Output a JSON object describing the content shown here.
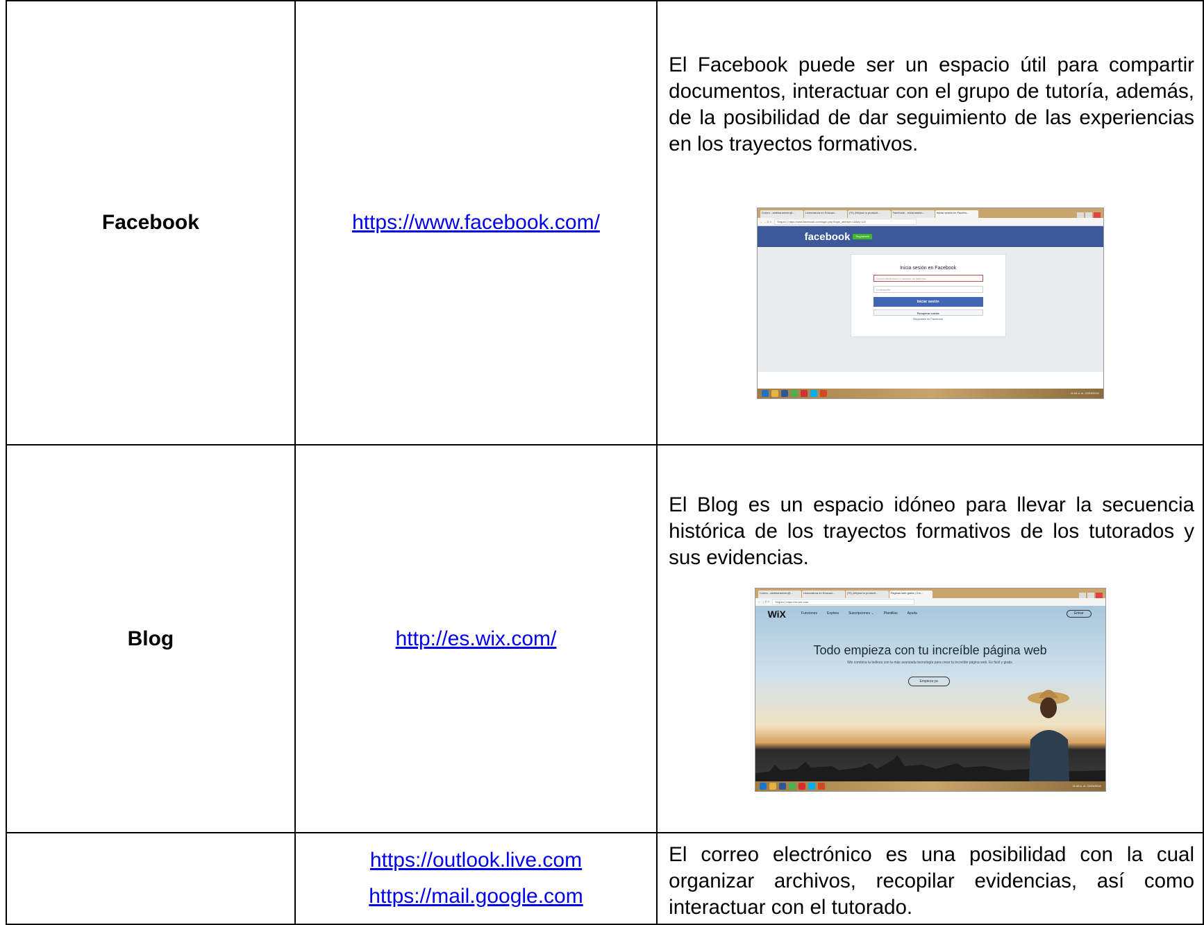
{
  "rows": [
    {
      "name": "Facebook",
      "link": "https://www.facebook.com/",
      "description": "El Facebook puede ser un espacio útil para compartir documentos, interactuar con el grupo de tutoría, además, de la posibilidad de dar seguimiento de las experiencias en los  trayectos formativos.",
      "screenshot": {
        "tabs": [
          "Correo - aldebaraniven@...",
          "Licenciatura en Educaci...",
          "(70) ¡Mejora tu producti...",
          "Facebook - inicia sesión...",
          "Iniciar sesión en Facebo..."
        ],
        "url": "Seguro | https://www.facebook.com/login.php?login_attempt=1&lwv=110",
        "logo": "facebook",
        "register": "Regístrarte",
        "card_title": "Inicia sesión en Facebook",
        "email_placeholder": "Correo electrónico o número de teléfono",
        "password_placeholder": "Contraseña",
        "login_button": "Iniciar sesión",
        "recover_button": "Recuperar cuenta",
        "signup_link": "Regístrate en Facebook",
        "clock": "11:44 a. m. 22/03/2018"
      }
    },
    {
      "name": "Blog",
      "link": "http://es.wix.com/",
      "description": "El Blog es un espacio idóneo para llevar la secuencia histórica de los trayectos formativos de los  tutorados y sus evidencias.",
      "screenshot": {
        "tabs": [
          "Correo - aldebaraniven@...",
          "Licenciatura en Educaci...",
          "(70) ¡Mejora tu producti...",
          "Páginas web gratis | Cre..."
        ],
        "url": "Seguro | https://es.wix.com",
        "logo": "WiX",
        "nav": [
          "Funciones",
          "Explora",
          "Suscripciones ⌄",
          "Plantillas",
          "Ayuda"
        ],
        "enter": "Entrar",
        "headline": "Todo empieza con tu increíble página web",
        "subline": "Wix combina la belleza con la más avanzada tecnología para crear tu increíble página web. Es fácil y gratis.",
        "cta": "Empieza ya",
        "clock": "11:49 a. m. 22/03/2018"
      }
    },
    {
      "name": "",
      "links": [
        "https://outlook.live.com",
        "https://mail.google.com"
      ],
      "description": "El correo electrónico es una posibilidad con la cual organizar archivos, recopilar evidencias,  así como interactuar con el tutorado."
    }
  ],
  "colors": {
    "link": "#0000ee",
    "facebook_blue": "#3b5998",
    "facebook_button": "#4267b2",
    "taskbar": "#c9a46c"
  },
  "icons": [
    "ie-icon",
    "explorer-icon",
    "word-icon",
    "chrome-icon",
    "acrobat-icon",
    "skype-icon",
    "powerpoint-icon"
  ]
}
